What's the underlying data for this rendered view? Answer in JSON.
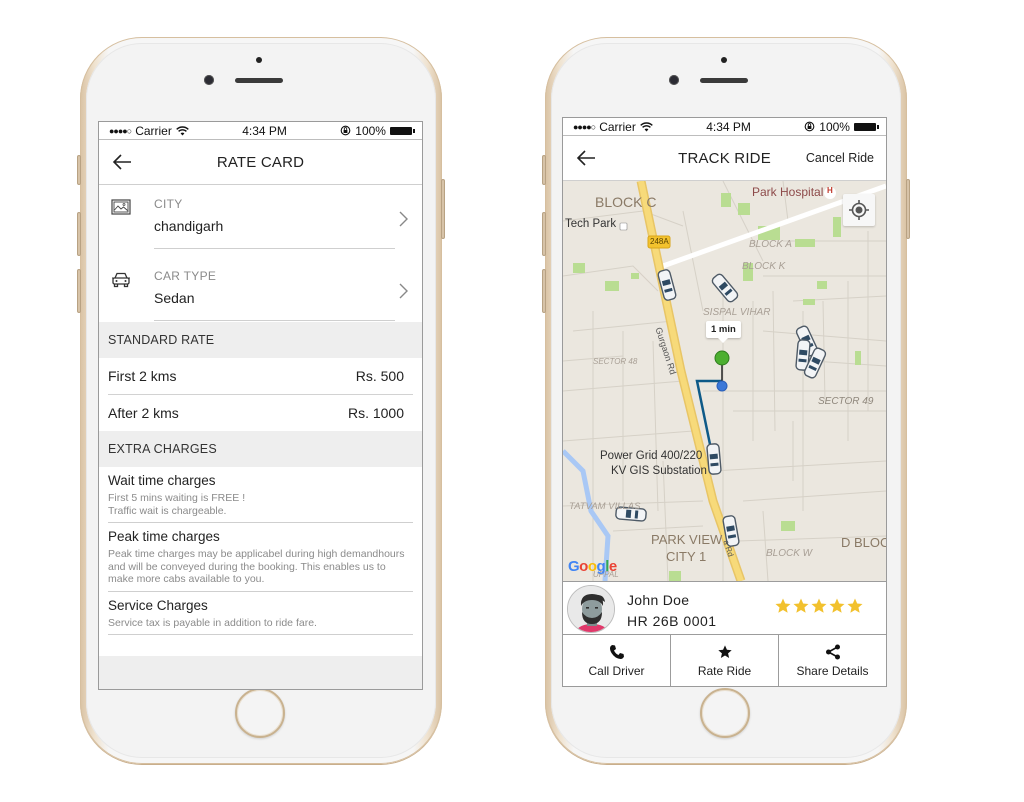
{
  "status_bar": {
    "carrier": "Carrier",
    "time": "4:34 PM",
    "battery": "100%"
  },
  "rate_card": {
    "title": "RATE CARD",
    "city": {
      "label": "CITY",
      "value": "chandigarh",
      "icon": "image-icon"
    },
    "car_type": {
      "label": "CAR TYPE",
      "value": "Sedan",
      "icon": "car-icon"
    },
    "standard_rate": {
      "heading": "STANDARD RATE",
      "rows": [
        {
          "label": "First 2 kms",
          "price": "Rs. 500"
        },
        {
          "label": "After 2 kms",
          "price": "Rs. 1000"
        }
      ]
    },
    "extra_charges": {
      "heading": "EXTRA CHARGES",
      "items": [
        {
          "title": "Wait time charges",
          "lines": [
            "First 5 mins waiting is FREE !",
            "Traffic wait is chargeable."
          ]
        },
        {
          "title": "Peak time charges",
          "lines": [
            "Peak time charges may be applicabel during high demandhours and will be conveyed during the booking. This enables us to make more cabs available to you."
          ]
        },
        {
          "title": "Service Charges",
          "lines": [
            "Service tax is payable in addition to ride fare."
          ]
        }
      ]
    }
  },
  "track_ride": {
    "title": "TRACK RIDE",
    "cancel_label": "Cancel Ride",
    "map": {
      "eta": "1 min",
      "labels": {
        "block_c": "BLOCK C",
        "tech_park": "Tech Park",
        "park_hospital": "Park Hospital",
        "route_shield": "248A",
        "block_a": "BLOCK A",
        "block_k": "BLOCK K",
        "sispal_vihar": "SISPAL VIHAR",
        "gurgaon_rd": "Gurgaon Rd",
        "sector_48": "SECTOR 48",
        "sector_49": "SECTOR 49",
        "power_grid": "Power Grid 400/220",
        "substation": "KV GIS Substation",
        "tatvam_villas": "TATVAM VILLAS",
        "park_view": "PARK VIEW",
        "city_1": "CITY 1",
        "block_w": "BLOCK W",
        "d_block": "D BLOC",
        "uppal": "UPPAL",
        "road_suffix": "a Rd",
        "hospital_marker": "H"
      },
      "attribution": "Google",
      "colors": {
        "land": "#ebe7df",
        "road_major": "#f5d76e",
        "park": "#b7dc8f",
        "water": "#a9c8f5",
        "route": "#0e5a88",
        "pickup_pin": "#4caf30",
        "driver_dot": "#3b78d8"
      }
    },
    "driver": {
      "name": "John Doe",
      "plate": "HR 26B 0001",
      "rating": 5,
      "rating_max": 5,
      "star_color": "#f2c12e"
    },
    "actions": [
      {
        "label": "Call Driver",
        "icon": "phone-icon"
      },
      {
        "label": "Rate Ride",
        "icon": "star-icon"
      },
      {
        "label": "Share Details",
        "icon": "share-icon"
      }
    ]
  }
}
